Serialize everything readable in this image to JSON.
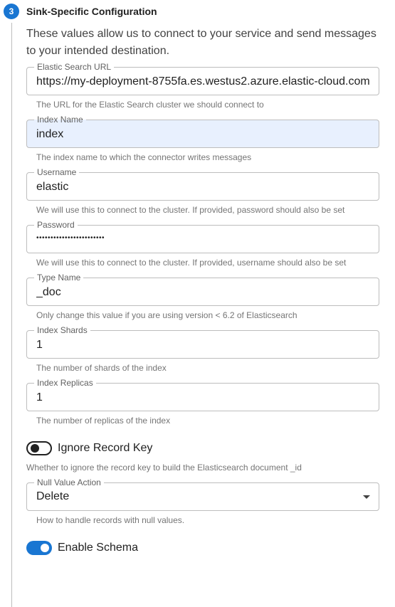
{
  "step": {
    "number": "3",
    "title": "Sink-Specific Configuration",
    "description": "These values allow us to connect to your service and send messages to your intended destination."
  },
  "fields": {
    "elastic_url": {
      "label": "Elastic Search URL",
      "value": "https://my-deployment-8755fa.es.westus2.azure.elastic-cloud.com",
      "helper": "The URL for the Elastic Search cluster we should connect to"
    },
    "index_name": {
      "label": "Index Name",
      "value": "index",
      "helper": "The index name to which the connector writes messages"
    },
    "username": {
      "label": "Username",
      "value": "elastic",
      "helper": "We will use this to connect to the cluster. If provided, password should also be set"
    },
    "password": {
      "label": "Password",
      "value": "••••••••••••••••••••••••",
      "helper": "We will use this to connect to the cluster. If provided, username should also be set"
    },
    "type_name": {
      "label": "Type Name",
      "value": "_doc",
      "helper": "Only change this value if you are using version < 6.2 of Elasticsearch"
    },
    "index_shards": {
      "label": "Index Shards",
      "value": "1",
      "helper": "The number of shards of the index"
    },
    "index_replicas": {
      "label": "Index Replicas",
      "value": "1",
      "helper": "The number of replicas of the index"
    }
  },
  "toggles": {
    "ignore_record_key": {
      "label": "Ignore Record Key",
      "checked": false,
      "helper": "Whether to ignore the record key to build the Elasticsearch document _id"
    },
    "enable_schema": {
      "label": "Enable Schema",
      "checked": true
    }
  },
  "null_value_action": {
    "label": "Null Value Action",
    "selected": "Delete",
    "helper": "How to handle records with null values."
  },
  "colors": {
    "accent": "#1976d2",
    "autofill": "#e8f0fe",
    "border": "#bdbdbd",
    "helper_text": "#757575"
  }
}
